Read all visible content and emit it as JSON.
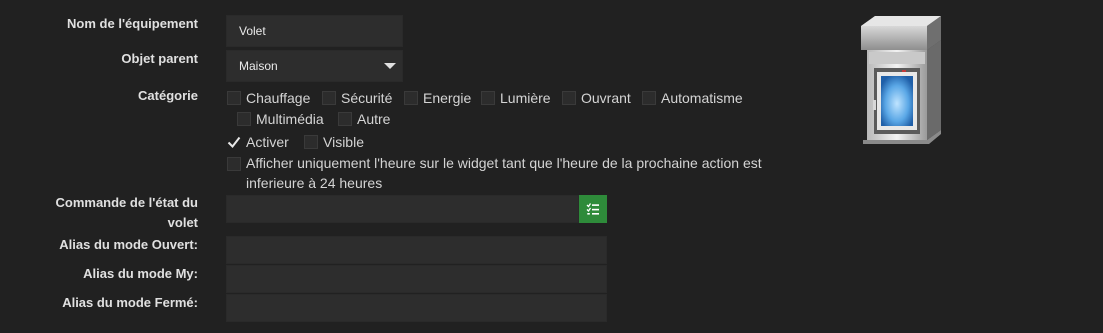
{
  "form": {
    "name_label": "Nom de l'équipement",
    "name_value": "Volet",
    "parent_label": "Objet parent",
    "parent_value": "Maison",
    "category_label": "Catégorie",
    "categories": [
      {
        "label": "Chauffage",
        "checked": false
      },
      {
        "label": "Sécurité",
        "checked": false
      },
      {
        "label": "Energie",
        "checked": false
      },
      {
        "label": "Lumière",
        "checked": false
      },
      {
        "label": "Ouvrant",
        "checked": false
      },
      {
        "label": "Automatisme",
        "checked": false
      },
      {
        "label": "Multimédia",
        "checked": false
      },
      {
        "label": "Autre",
        "checked": false
      }
    ],
    "activate_label": "Activer",
    "activate_checked": true,
    "visible_label": "Visible",
    "visible_checked": false,
    "show_hour_line1": "Afficher uniquement l'heure sur le widget tant que l'heure de la prochaine action est",
    "show_hour_line2": "inferieure à 24 heures",
    "show_hour_checked": false,
    "state_cmd_label_line1": "Commande de l'état du",
    "state_cmd_label_line2": "volet",
    "state_cmd_value": "",
    "state_cmd_button_icon": "list-check-icon",
    "alias_open_label": "Alias du mode Ouvert:",
    "alias_open_value": "",
    "alias_my_label": "Alias du mode My:",
    "alias_my_value": "",
    "alias_closed_label": "Alias du mode Fermé:",
    "alias_closed_value": ""
  },
  "image": {
    "icon": "roller-shutter-window-icon"
  },
  "colors": {
    "background": "#212121",
    "field": "#2d2d2d",
    "accent_button": "#2e8b3a"
  }
}
